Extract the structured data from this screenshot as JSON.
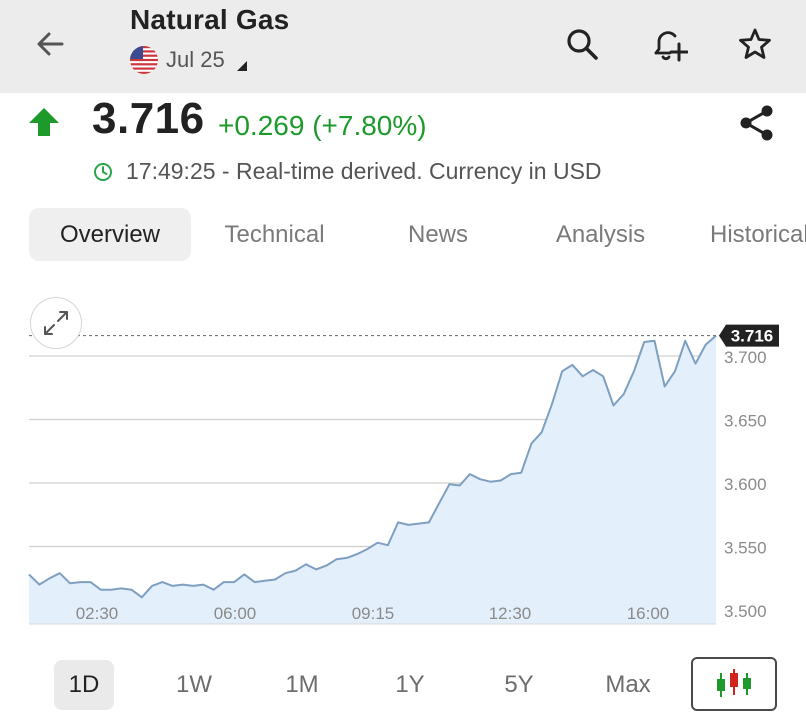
{
  "header": {
    "title": "Natural Gas",
    "contract": "Jul 25",
    "icons": [
      "back-arrow-icon",
      "search-icon",
      "add-alert-icon",
      "star-icon"
    ]
  },
  "quote": {
    "price": "3.716",
    "change": "+0.269 (+7.80%)",
    "time_note": "17:49:25 - Real-time derived. Currency in USD",
    "direction": "up",
    "up_color": "#1e9a2c"
  },
  "tabs": [
    {
      "label": "Overview",
      "active": true
    },
    {
      "label": "Technical",
      "active": false
    },
    {
      "label": "News",
      "active": false
    },
    {
      "label": "Analysis",
      "active": false
    },
    {
      "label": "Historical",
      "active": false
    }
  ],
  "timeframes": [
    {
      "label": "1D",
      "active": true
    },
    {
      "label": "1W",
      "active": false
    },
    {
      "label": "1M",
      "active": false
    },
    {
      "label": "1Y",
      "active": false
    },
    {
      "label": "5Y",
      "active": false
    },
    {
      "label": "Max",
      "active": false
    }
  ],
  "chart_data": {
    "type": "area",
    "x_ticks": [
      "02:30",
      "06:00",
      "09:15",
      "12:30",
      "16:00"
    ],
    "y_ticks": [
      "3.500",
      "3.550",
      "3.600",
      "3.650",
      "3.700"
    ],
    "ylim": [
      3.485,
      3.725
    ],
    "current_label": "3.716",
    "current_value": 3.716,
    "line_color": "#7e9fc0",
    "fill_color": "#e3effb",
    "grid": true,
    "series": [
      {
        "values": [
          3.528,
          3.52,
          3.525,
          3.529,
          3.521,
          3.522,
          3.522,
          3.516,
          3.516,
          3.517,
          3.516,
          3.51,
          3.519,
          3.522,
          3.519,
          3.52,
          3.519,
          3.52,
          3.516,
          3.522,
          3.522,
          3.528,
          3.522,
          3.523,
          3.524,
          3.529,
          3.531,
          3.536,
          3.532,
          3.535,
          3.54,
          3.541,
          3.544,
          3.548,
          3.553,
          3.551,
          3.569,
          3.567,
          3.568,
          3.569,
          3.584,
          3.599,
          3.598,
          3.607,
          3.603,
          3.601,
          3.602,
          3.607,
          3.608,
          3.631,
          3.64,
          3.662,
          3.688,
          3.693,
          3.684,
          3.689,
          3.684,
          3.661,
          3.67,
          3.688,
          3.711,
          3.712,
          3.676,
          3.688,
          3.712,
          3.694,
          3.709,
          3.716
        ]
      }
    ]
  }
}
